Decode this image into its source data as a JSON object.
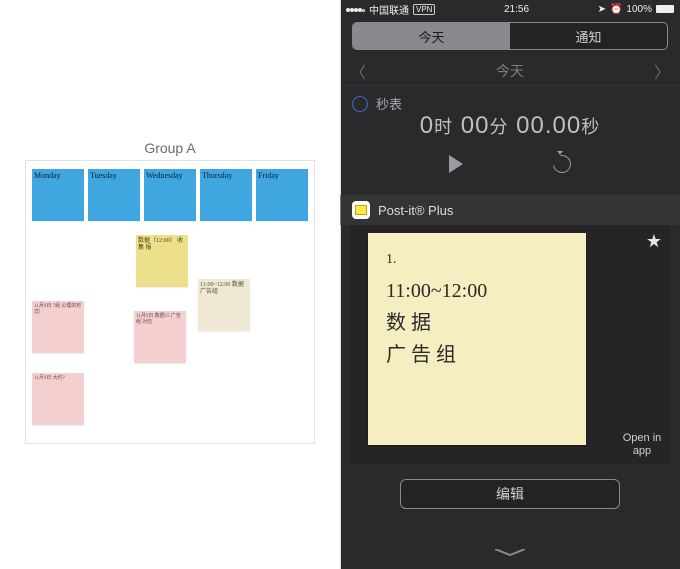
{
  "left": {
    "board_title": "Group A",
    "notes": {
      "blue": [
        "Monday",
        "Tuesday",
        "Wednesday",
        "Thursday",
        "Friday"
      ],
      "yellow1": "数据（12:00）\n收集 报",
      "yellow2": "11:00~12:00\n数据\n广告组",
      "pink1": "11月9日\n7组\n公理的形式!",
      "pink2": "11月9日\n数据15\n广告组\n对应",
      "pink3": "11月9日\n大约?"
    }
  },
  "right": {
    "statusbar": {
      "carrier": "中国联通",
      "vpn": "VPN",
      "time": "21:56",
      "battery": "100%"
    },
    "segments": {
      "today": "今天",
      "notifications": "通知"
    },
    "daynav": {
      "label": "今天"
    },
    "stopwatch": {
      "title": "秒表",
      "display_h": "0",
      "unit_h": "时",
      "display_m": "00",
      "unit_m": "分",
      "display_s": "00.00",
      "unit_s": "秒"
    },
    "postit": {
      "title": "Post-it® Plus",
      "note_l1": "1.",
      "note_l2": "11:00~12:00",
      "note_l3": "数 据",
      "note_l4": "广 告 组",
      "open_label": "Open in app"
    },
    "edit_label": "编辑"
  }
}
